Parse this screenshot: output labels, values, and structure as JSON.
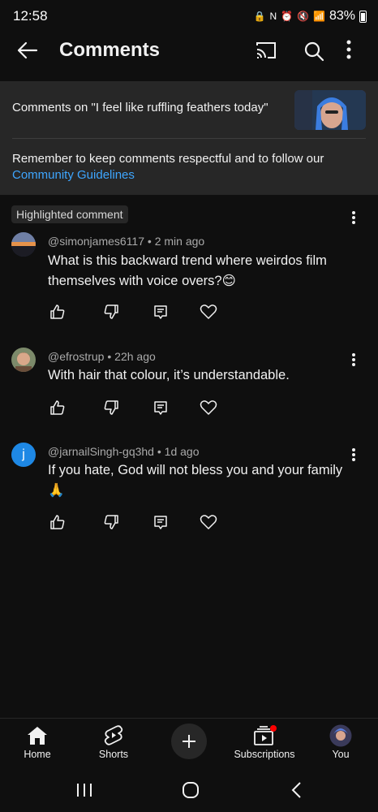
{
  "status_bar": {
    "time": "12:58",
    "battery": "83%"
  },
  "app_bar": {
    "title": "Comments"
  },
  "context": {
    "label": "Comments on \"I feel like ruffling feathers today\"",
    "guidelines_text": "Remember to keep comments respectful and to follow our",
    "guidelines_link": "Community Guidelines"
  },
  "highlighted_badge": "Highlighted comment",
  "comments": [
    {
      "author": "@simonjames6117",
      "time": "2 min ago",
      "text": "What is this backward trend where weirdos film themselves with voice overs?😊"
    },
    {
      "author": "@efrostrup",
      "time": "22h ago",
      "text": "With hair that colour, it’s understandable."
    },
    {
      "author": "@jarnailSingh-gq3hd",
      "time": "1d ago",
      "text": "If you hate, God will not bless you and your family 🙏",
      "avatar_letter": "j"
    }
  ],
  "bottom_nav": {
    "items": [
      {
        "label": "Home",
        "icon": "home-icon"
      },
      {
        "label": "Shorts",
        "icon": "shorts-icon"
      },
      {
        "label": "Subscriptions",
        "icon": "subscriptions-icon"
      },
      {
        "label": "You",
        "icon": "avatar"
      }
    ]
  },
  "colors": {
    "background": "#0f0f0f",
    "panel": "#272727",
    "link": "#3ea6ff",
    "avatar_j": "#1e88e5",
    "notification_dot": "#ff0000"
  }
}
